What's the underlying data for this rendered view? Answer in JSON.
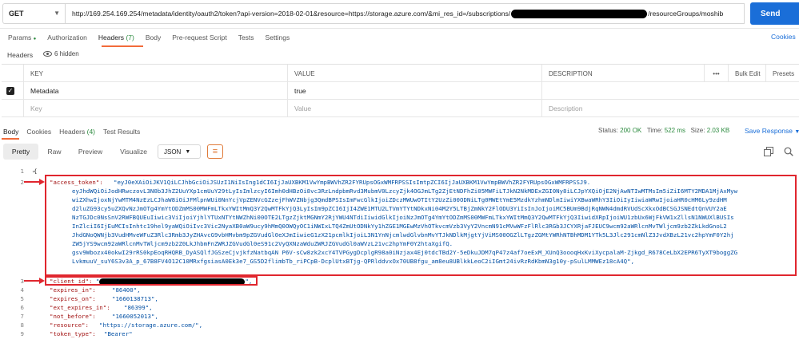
{
  "request": {
    "method": "GET",
    "url_part1": "http://169.254.169.254/metadata/identity/oauth2/token?api-version=2018-02-01&resource=https://storage.azure.com/&mi_res_id=/subscriptions/",
    "url_part2": "/resourceGroups/moshib",
    "send_label": "Send"
  },
  "request_tabs": [
    {
      "label": "Params",
      "dot": "●"
    },
    {
      "label": "Authorization"
    },
    {
      "label": "Headers",
      "count": "(7)"
    },
    {
      "label": "Body"
    },
    {
      "label": "Pre-request Script"
    },
    {
      "label": "Tests"
    },
    {
      "label": "Settings"
    }
  ],
  "cookies_link": "Cookies",
  "headers_section": {
    "label": "Headers",
    "hidden_toggle": "6 hidden",
    "columns": {
      "key": "KEY",
      "value": "VALUE",
      "description": "DESCRIPTION",
      "more": "•••",
      "bulk_edit": "Bulk Edit",
      "presets": "Presets"
    },
    "rows": [
      {
        "checked": true,
        "key": "Metadata",
        "value": "true",
        "description": ""
      }
    ],
    "placeholder": {
      "key": "Key",
      "value": "Value",
      "description": "Description"
    }
  },
  "response_tabs": [
    {
      "label": "Body"
    },
    {
      "label": "Cookies"
    },
    {
      "label": "Headers",
      "count": "(4)"
    },
    {
      "label": "Test Results"
    }
  ],
  "response_status": {
    "status_label": "Status:",
    "status_value": "200 OK",
    "time_label": "Time:",
    "time_value": "522 ms",
    "size_label": "Size:",
    "size_value": "2.03 KB",
    "save_label": "Save Response"
  },
  "view_tabs": [
    "Pretty",
    "Raw",
    "Preview",
    "Visualize"
  ],
  "format_select": "JSON",
  "code": {
    "line1": "{",
    "access_token_key": "\"access_token\":",
    "access_token_lines": [
      "\"eyJ0eXAiOiJKV1QiLCJhbGciOiJSUzI1NiIsIng1dCI6IjJaUXBKM1VwYmpBWVhZR2FYRUpsOGxWMFRPSSIsImtpZCI6IjJaUXBKM1VwYmpBWVhZR2FYRUpsOGxWMFRPSSJ9.",
      "eyJhdWQiOiJodHRwczovL3N0b3JhZ2UuYXp1cmUuY29tLyIsImlzcyI6Imh0dHBzOi8vc3RzLndpbmRvd3MubmV0LzcyZjk4OGJmLTg2ZjEtNDFhZi05MWFiLTJkN2NkMDExZGI0Ny8iLCJpYXQiOjE2NjAwNTIwMTMsIm5iZiI6MTY2MDA1MjAxMyw",
      "wiZXhwIjoxNjYwMTM4NzEzLCJhaW8iOiJFMlpnWUi0NnYcjVpZENVcGZzejFhWVZNbjg3QmdBPSIsImFwcGlkIjoiZDczMWUwOTItY2UzZi00ODNiLTg0MWEtYmE5MzdkYzhmNDlmIiwiYXBwaWRhY3IiOiIyIiwiaWRwIjoiaHR0cHM6Ly9zdHM",
      "d2luZG93cy5uZXQvNzJmOTg4YmYtODZmMS00MWFmLTkxYWItMmQ3Y2QwMTFkYjQ3LyIsIm9pZCI6IjI4ZWE1MTU2LTVmYTYtNDkxNi04M2Y5LTBjZmNkY2FlODU3YiIsInJoIjoiMC5BUm9BdjRqNWN4dmdRVUdScXkxOdBCSGJSNEdtQnVUY2aE",
      "NzTGJDc0NsSnV2RWFBQUEuIiwic3ViIjoiYjhlYTUxNTYtNWZhNi00OTE2LTgzZjktMGNmY2RjYWU4NTdiIiwidGlkIjoiNzJmOTg4YmYtODZmMS00MWFmLTkxYWItMmQ3Y2QwMTFkYjQ3IiwidXRpIjoiWU1zbUx6WjFkVW1xZllsN1NWUXlBUSIs",
      "InZlciI6IjEuMCIsInhtc19hel9yaWQiOiIvc3Vic2NyaXB0aW9ucy9hMmQ0OWQyOC1iNWIxLTQ4ZmUtODNkYy1hZGE1MGEwMzVhOTkvcmVzb3VyY2VncmN91cMVwWFzFlRlc3RGb3JCYXRjaFJEUC9wcm92aWRlcnMvTWljcm9zb2ZkLkdGnoL2",
      "JhdGNoQWNjb3VudHMveWFuZ3Rlc3Rmb3JyZHAvcG9vbHMvbm9pZGVudGl0eXJmIiwieG1zX21pcmlkIjoiL3N1YnNjcmlwdGlvbnMvYTJkNDlkMjgtYjViMS00OGZlLTgzZGMtYWRhNTBhMDM1YTk5L3Jlc291cmNlZ3JvdXBzL21vc2hpYmF0Y2hj",
      "ZW5jYS9wcm92aWRlcnMvTWljcm9zb2Z0LkJhbmFnZWRJZGVudGl0eS91c2VyQXNzaWduZWRJZGVudGl0aWVzL21vc2hpYmF0Y2htaXgifQ.",
      "gsv9Wbozx40okwI29rRS0kpEoqRHQRB_DyASQlfJGSzeCjvjkfzNatbqAN P6V-sCw8zk2xcY4TVPGygDcplgR98a0iNzjax4Ej0tdcTBd2Y-5eDkuJDM7qP47z4af7oeExM_XUnQ3oooqHxKviXycpalaM-Zjkgd_R678CeLbX2EPR6TyXT9boggZG",
      "LvkmuuV_suY6S3v3A_p_67B8FV4O12C10MRxfgsiasA0Ek3e7_GS5D2flimbTb_riPCpB-DcplUtxBTjg-QPRlddvxOx70UB8fgu_am8eu8UBlkkLeoC2iIGmt24ivRzRdKbmN3g10y-pSulLMMWEz18cA4Q\","
    ],
    "client_id_key": "\"client_id\":",
    "client_id_suffix": "\",",
    "client_id_prefix": "\"",
    "lines": [
      {
        "key": "\"expires_in\":",
        "value": "\"86400\","
      },
      {
        "key": "\"expires_on\":",
        "value": "\"1660138713\","
      },
      {
        "key": "\"ext_expires_in\":",
        "value": "\"86399\","
      },
      {
        "key": "\"not_before\":",
        "value": "\"1660052013\","
      },
      {
        "key": "\"resource\":",
        "value": "\"https://storage.azure.com/\","
      },
      {
        "key": "\"token_type\":",
        "value": "\"Bearer\""
      }
    ],
    "line_numbers": [
      "1",
      "2",
      "3",
      "4",
      "5",
      "6",
      "7",
      "8",
      "9"
    ]
  },
  "colors": {
    "accent": "#f26b3a",
    "send": "#1a6ed8",
    "annotation": "#e0262e",
    "status_ok": "#2b8a3e"
  },
  "icons": [
    "chevron-down-icon",
    "eye-icon",
    "checkbox-icon",
    "wrap-lines-icon",
    "copy-icon",
    "search-icon",
    "fold-icon"
  ]
}
